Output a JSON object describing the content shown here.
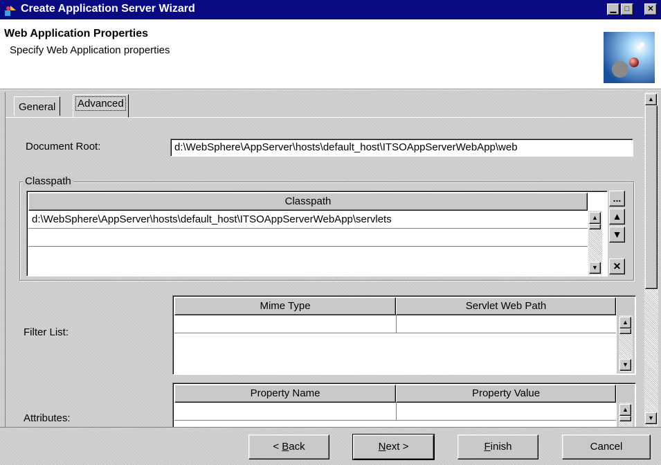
{
  "window": {
    "title": "Create Application Server Wizard",
    "controls": {
      "minimize": "▁",
      "maximize": "□",
      "close": "✕"
    }
  },
  "header": {
    "title": "Web Application Properties",
    "subtitle": "Specify Web Application properties",
    "logo_icon": "globe-wizard-icon"
  },
  "tabs": [
    {
      "label": "General",
      "active": false
    },
    {
      "label": "Advanced",
      "active": true
    }
  ],
  "document_root": {
    "label": "Document Root:",
    "value": "d:\\WebSphere\\AppServer\\hosts\\default_host\\ITSOAppServerWebApp\\web"
  },
  "classpath": {
    "group_label": "Classpath",
    "column": "Classpath",
    "rows": [
      "d:\\WebSphere\\AppServer\\hosts\\default_host\\ITSOAppServerWebApp\\servlets",
      ""
    ],
    "buttons": {
      "browse": "...",
      "up": "▲",
      "down": "▼",
      "remove": "✕"
    }
  },
  "filter_list": {
    "label": "Filter List:",
    "columns": [
      "Mime Type",
      "Servlet Web Path"
    ]
  },
  "attributes": {
    "label": "Attributes:",
    "columns": [
      "Property Name",
      "Property Value"
    ]
  },
  "buttons": {
    "back": {
      "prefix": "< ",
      "mnemonic": "B",
      "rest": "ack"
    },
    "next": {
      "mnemonic": "N",
      "rest": "ext >"
    },
    "finish": {
      "mnemonic": "F",
      "rest": "inish"
    },
    "cancel": "Cancel"
  },
  "colors": {
    "titlebar": "#0a0a82",
    "panel": "#c9c9c9"
  }
}
